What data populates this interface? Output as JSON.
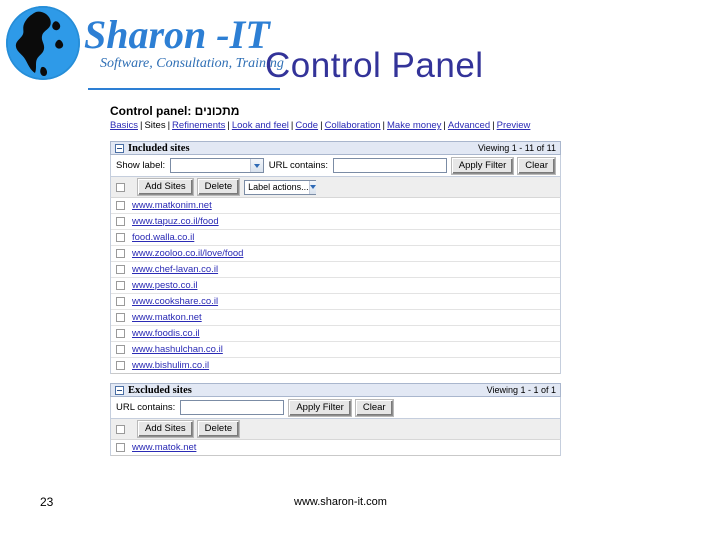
{
  "slide": {
    "title": "Control Panel",
    "logo": {
      "name": "Sharon -IT",
      "tagline": "Software, Consultation, Training",
      "icon": "globe-icon"
    },
    "footer": {
      "slide_number": "23",
      "website": "www.sharon-it.com"
    },
    "colors": {
      "title": "#333399",
      "logo_blue": "#2d7fd4",
      "link": "#2b2bb5",
      "section_bar": "#e2e8f4"
    }
  },
  "control_panel": {
    "heading": "Control panel: מתכונים",
    "nav": [
      {
        "label": "Basics",
        "current": false
      },
      {
        "label": "Sites",
        "current": true
      },
      {
        "label": "Refinements",
        "current": false
      },
      {
        "label": "Look and feel",
        "current": false
      },
      {
        "label": "Code",
        "current": false
      },
      {
        "label": "Collaboration",
        "current": false
      },
      {
        "label": "Make money",
        "current": false
      },
      {
        "label": "Advanced",
        "current": false
      },
      {
        "label": "Preview",
        "current": false
      }
    ],
    "included": {
      "section_title": "Included sites",
      "viewing": "Viewing 1 - 11 of 11",
      "show_label": "Show label:",
      "show_label_value": "",
      "url_contains": "URL contains:",
      "url_contains_value": "",
      "apply_filter": "Apply Filter",
      "clear": "Clear",
      "add_sites": "Add Sites",
      "delete": "Delete",
      "label_actions": "Label actions...",
      "sites": [
        "www.matkonim.net",
        "www.tapuz.co.il/food",
        "food.walla.co.il",
        "www.zooloo.co.il/love/food",
        "www.chef-lavan.co.il",
        "www.pesto.co.il",
        "www.cookshare.co.il",
        "www.matkon.net",
        "www.foodis.co.il",
        "www.hashulchan.co.il",
        "www.bishulim.co.il"
      ]
    },
    "excluded": {
      "section_title": "Excluded sites",
      "viewing": "Viewing 1 - 1 of 1",
      "url_contains": "URL contains:",
      "url_contains_value": "",
      "apply_filter": "Apply Filter",
      "clear": "Clear",
      "add_sites": "Add Sites",
      "delete": "Delete",
      "sites": [
        "www.matok.net"
      ]
    }
  }
}
